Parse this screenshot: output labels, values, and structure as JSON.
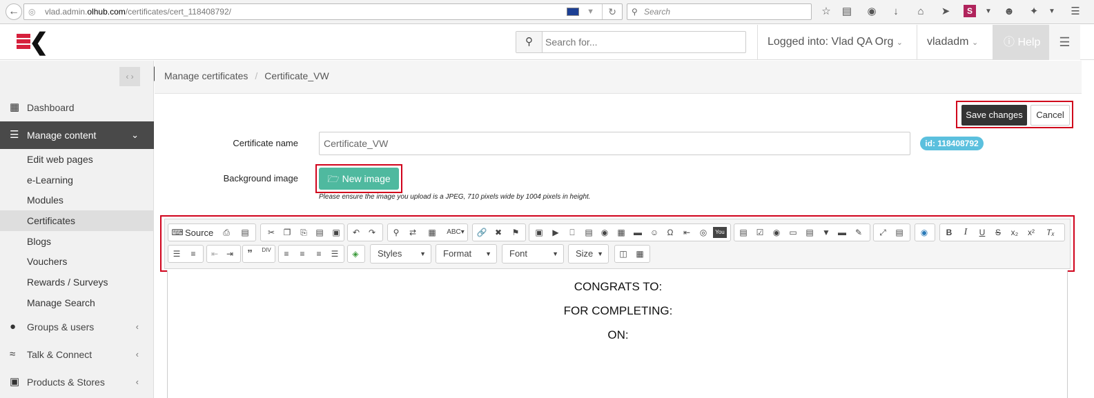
{
  "browser": {
    "url_prefix": "vlad.admin.",
    "url_host": "olhub.com",
    "url_path": "/certificates/cert_118408792/",
    "search_placeholder": "Search"
  },
  "header": {
    "search_placeholder": "Search for...",
    "org_label": "Logged into: Vlad QA Org",
    "user_label": "vladadm",
    "help_label": "Help"
  },
  "sidebar": {
    "items": [
      {
        "label": "Dashboard"
      },
      {
        "label": "Manage content"
      },
      {
        "label": "Groups & users"
      },
      {
        "label": "Talk & Connect"
      },
      {
        "label": "Products & Stores"
      }
    ],
    "sub_items": [
      {
        "label": "Edit web pages"
      },
      {
        "label": "e-Learning"
      },
      {
        "label": "Modules"
      },
      {
        "label": "Certificates"
      },
      {
        "label": "Blogs"
      },
      {
        "label": "Vouchers"
      },
      {
        "label": "Rewards / Surveys"
      },
      {
        "label": "Manage Search"
      }
    ]
  },
  "breadcrumb": {
    "root": "Manage certificates",
    "separator": "/",
    "current": "Certificate_VW"
  },
  "form": {
    "save_label": "Save changes",
    "cancel_label": "Cancel",
    "name_label": "Certificate name",
    "name_value": "Certificate_VW",
    "id_badge": "id: 118408792",
    "background_label": "Background image",
    "new_image_label": "New image",
    "hint": "Please ensure the image you upload is a JPEG, 710 pixels wide by 1004 pixels in height."
  },
  "editor": {
    "source_label": "Source",
    "styles_label": "Styles",
    "format_label": "Format",
    "font_label": "Font",
    "size_label": "Size",
    "content_lines": [
      "CONGRATS TO:",
      "FOR COMPLETING:",
      "ON:"
    ]
  },
  "colors": {
    "highlight": "#d0021b",
    "accent": "#4fb99f",
    "badge": "#5bc0de",
    "active_nav": "#494949"
  }
}
